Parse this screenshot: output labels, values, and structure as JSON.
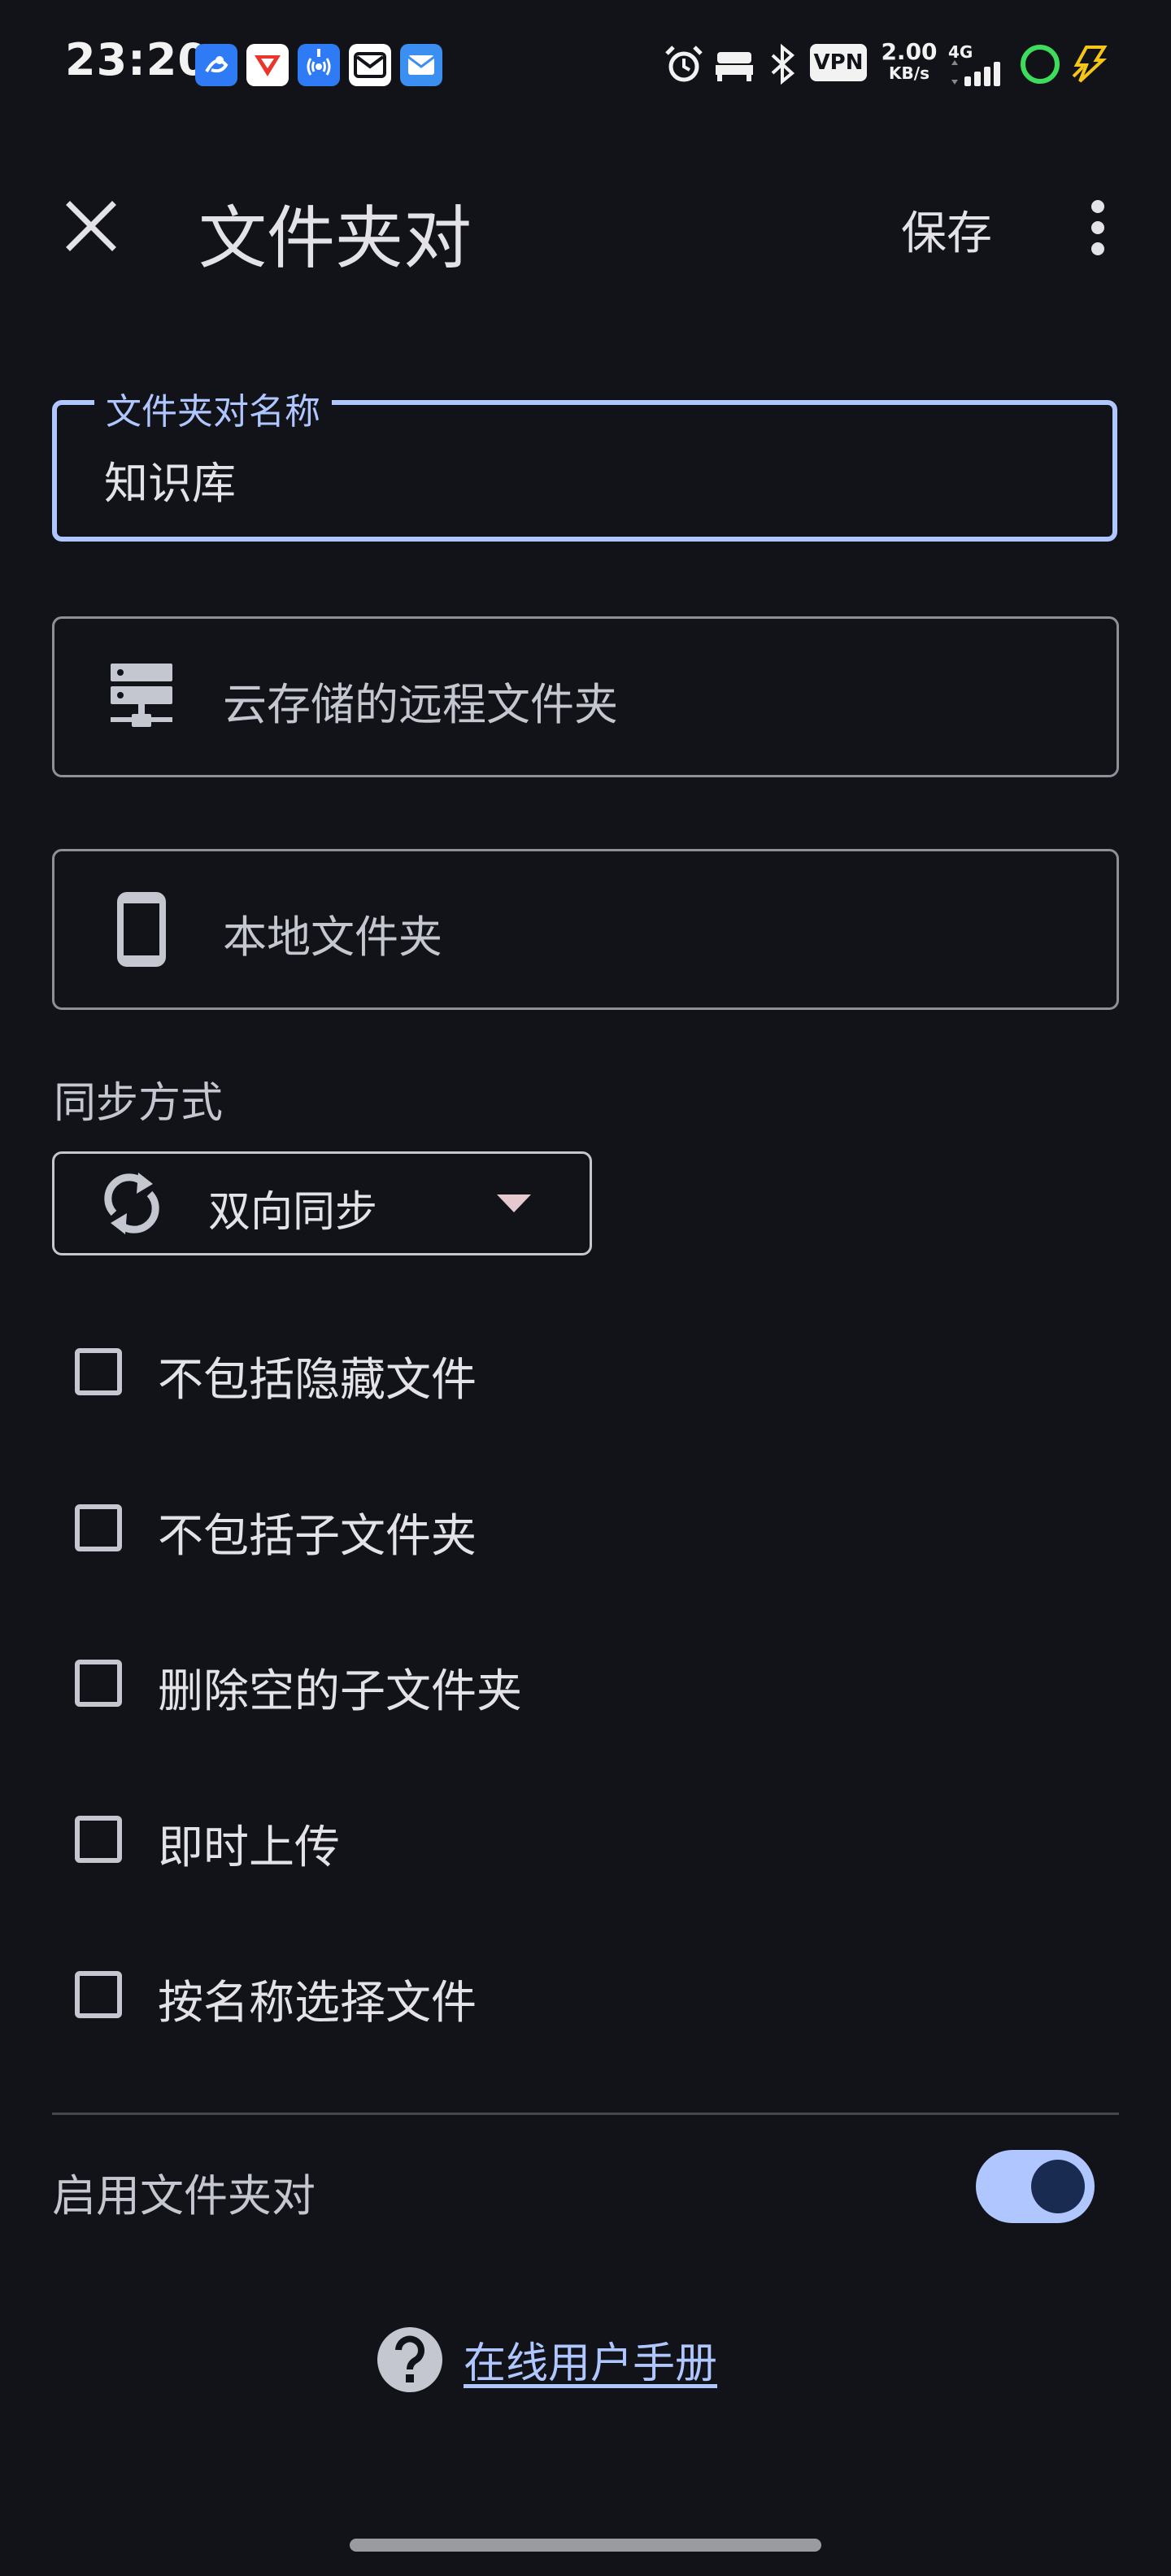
{
  "status_bar": {
    "time": "23:20",
    "vpn": "VPN",
    "speed_value": "2.00",
    "speed_unit": "KB/s",
    "network": "4G"
  },
  "app_bar": {
    "title": "文件夹对",
    "save_label": "保存"
  },
  "name_field": {
    "label": "文件夹对名称",
    "value": "知识库"
  },
  "remote_folder": {
    "label": "云存储的远程文件夹",
    "icon": "server-icon"
  },
  "local_folder": {
    "label": "本地文件夹",
    "icon": "phone-icon"
  },
  "sync": {
    "section_title": "同步方式",
    "selected": "双向同步"
  },
  "options": [
    {
      "label": "不包括隐藏文件",
      "checked": false
    },
    {
      "label": "不包括子文件夹",
      "checked": false
    },
    {
      "label": "删除空的子文件夹",
      "checked": false
    },
    {
      "label": "即时上传",
      "checked": false
    },
    {
      "label": "按名称选择文件",
      "checked": false
    }
  ],
  "enable": {
    "label": "启用文件夹对",
    "on": true
  },
  "help": {
    "link": "在线用户手册"
  },
  "colors": {
    "background": "#111318",
    "accent": "#b0c6ff",
    "outline": "#8e9099"
  }
}
